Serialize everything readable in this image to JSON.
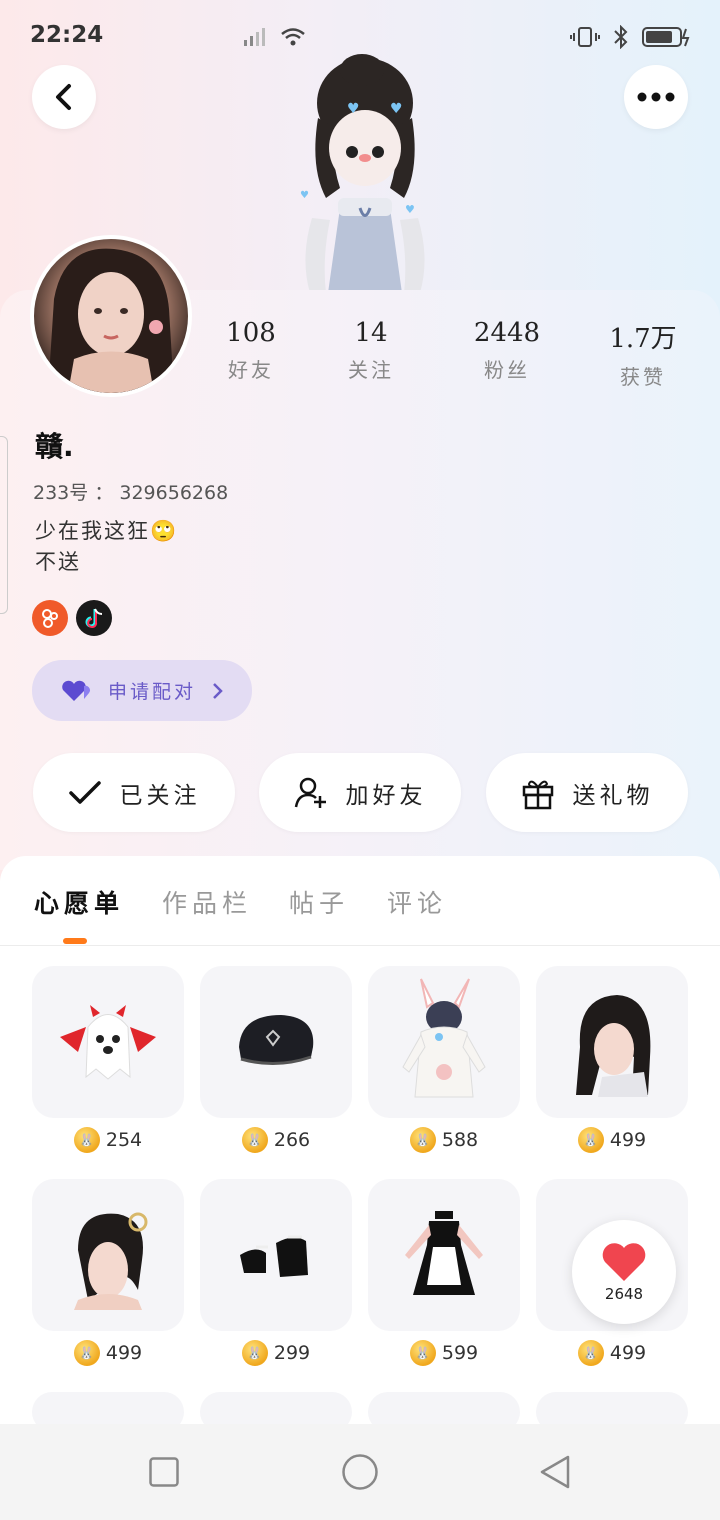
{
  "status_bar": {
    "time": "22:24"
  },
  "profile": {
    "name": "贛.",
    "id_label": "233号",
    "id_sep": "：",
    "id_value": "329656268",
    "bio_line1": "少在我这狂🙄",
    "bio_line2": "不送"
  },
  "stats": [
    {
      "value": "108",
      "label": "好友"
    },
    {
      "value": "14",
      "label": "关注"
    },
    {
      "value": "2448",
      "label": "粉丝"
    },
    {
      "value": "1.7万",
      "label": "获赞"
    }
  ],
  "pair_button": {
    "label": "申请配对"
  },
  "actions": {
    "follow": "已关注",
    "add_friend": "加好友",
    "gift": "送礼物"
  },
  "tabs": [
    "心愿单",
    "作品栏",
    "帖子",
    "评论"
  ],
  "wishlist": [
    {
      "price": "254",
      "icon": "ghost-devil-icon"
    },
    {
      "price": "266",
      "icon": "black-cap-icon"
    },
    {
      "price": "588",
      "icon": "bunny-hoodie-icon"
    },
    {
      "price": "499",
      "icon": "short-hair-icon"
    },
    {
      "price": "499",
      "icon": "bun-hair-icon"
    },
    {
      "price": "299",
      "icon": "platform-shoes-icon"
    },
    {
      "price": "599",
      "icon": "maid-dress-icon"
    },
    {
      "price": "499",
      "icon": "item-icon"
    }
  ],
  "like_float": {
    "count": "2648"
  },
  "colors": {
    "accent": "#ff7a1a",
    "pair_text": "#6a5bc8",
    "pair_bg": "#e3dcf3",
    "heart": "#f0454f"
  }
}
